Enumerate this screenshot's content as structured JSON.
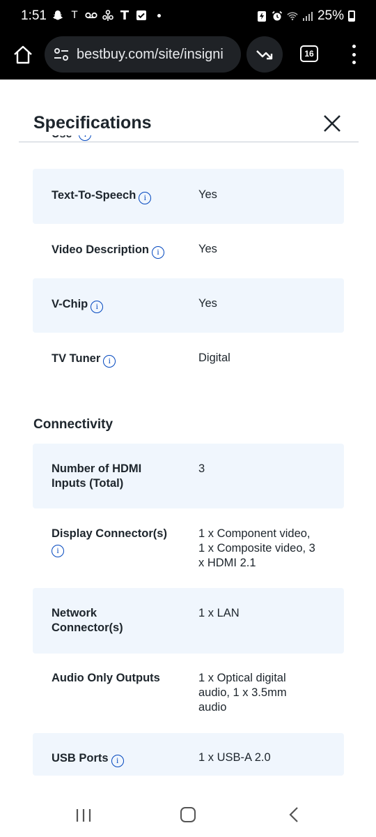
{
  "status_bar": {
    "time": "1:51",
    "battery": "25%",
    "icons_left": [
      "snapchat-icon",
      "t-mobile-icon",
      "voicemail-icon",
      "share-icon",
      "t-mobile-icon",
      "checkbox-icon"
    ],
    "icons_right": [
      "battery-saver-icon",
      "alarm-icon",
      "wifi-icon",
      "signal-icon"
    ]
  },
  "browser": {
    "url": "bestbuy.com/site/insigni",
    "tab_count": "16"
  },
  "page": {
    "title": "Specifications",
    "clipped_label": "Use"
  },
  "specs_top": [
    {
      "label": "Text-To-Speech",
      "value": "Yes",
      "info": true
    },
    {
      "label": "Video Description",
      "value": "Yes",
      "info": true
    },
    {
      "label": "V-Chip",
      "value": "Yes",
      "info": true
    },
    {
      "label": "TV Tuner",
      "value": "Digital",
      "info": true
    }
  ],
  "connectivity": {
    "title": "Connectivity",
    "rows": [
      {
        "label_line1": "Number of HDMI",
        "label_line2": "Inputs (Total)",
        "value_lines": [
          "3"
        ]
      },
      {
        "label_line1": "Display Connector(s)",
        "value_lines": [
          "1 x Component video,",
          "1 x Composite video, 3",
          "x HDMI 2.1"
        ],
        "info": true
      },
      {
        "label_line1": "Network",
        "label_line2": "Connector(s)",
        "value_lines": [
          "1 x LAN"
        ]
      },
      {
        "label_line1": "Audio Only Outputs",
        "value_lines": [
          "1 x Optical digital",
          "audio, 1 x 3.5mm",
          "audio"
        ]
      },
      {
        "label_line1": "USB Ports",
        "value_lines": [
          "1 x USB-A 2.0"
        ],
        "info": true
      }
    ]
  },
  "colors": {
    "row_shade": "#f0f6fd",
    "info_blue": "#0046be",
    "text": "#1d252c"
  }
}
